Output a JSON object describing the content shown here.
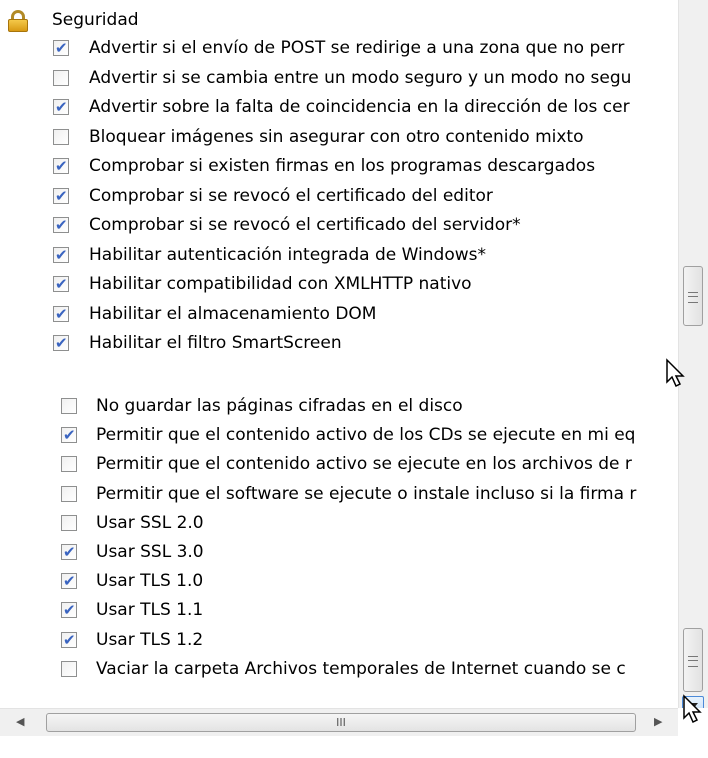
{
  "top_panel": {
    "group_title": "Seguridad",
    "items": [
      {
        "label": "Advertir si el envío de POST se redirige a una zona que no perr",
        "checked": true
      },
      {
        "label": "Advertir si se cambia entre un modo seguro y un modo no segu",
        "checked": false
      },
      {
        "label": "Advertir sobre la falta de coincidencia en la dirección de los cer",
        "checked": true
      },
      {
        "label": "Bloquear imágenes sin asegurar con otro contenido mixto",
        "checked": false
      },
      {
        "label": "Comprobar si existen firmas en los programas descargados",
        "checked": true
      },
      {
        "label": "Comprobar si se revocó el certificado del editor",
        "checked": true
      },
      {
        "label": "Comprobar si se revocó el certificado del servidor*",
        "checked": true
      },
      {
        "label": "Habilitar autenticación integrada de Windows*",
        "checked": true
      },
      {
        "label": "Habilitar compatibilidad con XMLHTTP nativo",
        "checked": true
      },
      {
        "label": "Habilitar el almacenamiento DOM",
        "checked": true
      },
      {
        "label": "Habilitar el filtro SmartScreen",
        "checked": true
      }
    ]
  },
  "bottom_panel": {
    "items": [
      {
        "label": "No guardar las páginas cifradas en el disco",
        "checked": false
      },
      {
        "label": "Permitir que el contenido activo de los CDs se ejecute en mi eq",
        "checked": true
      },
      {
        "label": "Permitir que el contenido activo se ejecute en los archivos de r",
        "checked": false
      },
      {
        "label": "Permitir que el software se ejecute o instale incluso si la firma r",
        "checked": false
      },
      {
        "label": "Usar SSL 2.0",
        "checked": false
      },
      {
        "label": "Usar SSL 3.0",
        "checked": true
      },
      {
        "label": "Usar TLS 1.0",
        "checked": true
      },
      {
        "label": "Usar TLS 1.1",
        "checked": true
      },
      {
        "label": "Usar TLS 1.2",
        "checked": true
      },
      {
        "label": "Vaciar la carpeta Archivos temporales de Internet cuando se c",
        "checked": false
      }
    ]
  },
  "icons": {
    "group": "lock-icon",
    "scroll_grip": "grip-icon",
    "scroll_down": "down-arrow-icon",
    "scroll_left": "left-arrow-icon",
    "scroll_right": "right-arrow-icon",
    "cursor": "mouse-pointer-icon"
  },
  "hscroll": {
    "thumb_glyph": "III"
  },
  "colors": {
    "check": "#3a64c0",
    "scroll_button_border": "#4b8ad8"
  }
}
